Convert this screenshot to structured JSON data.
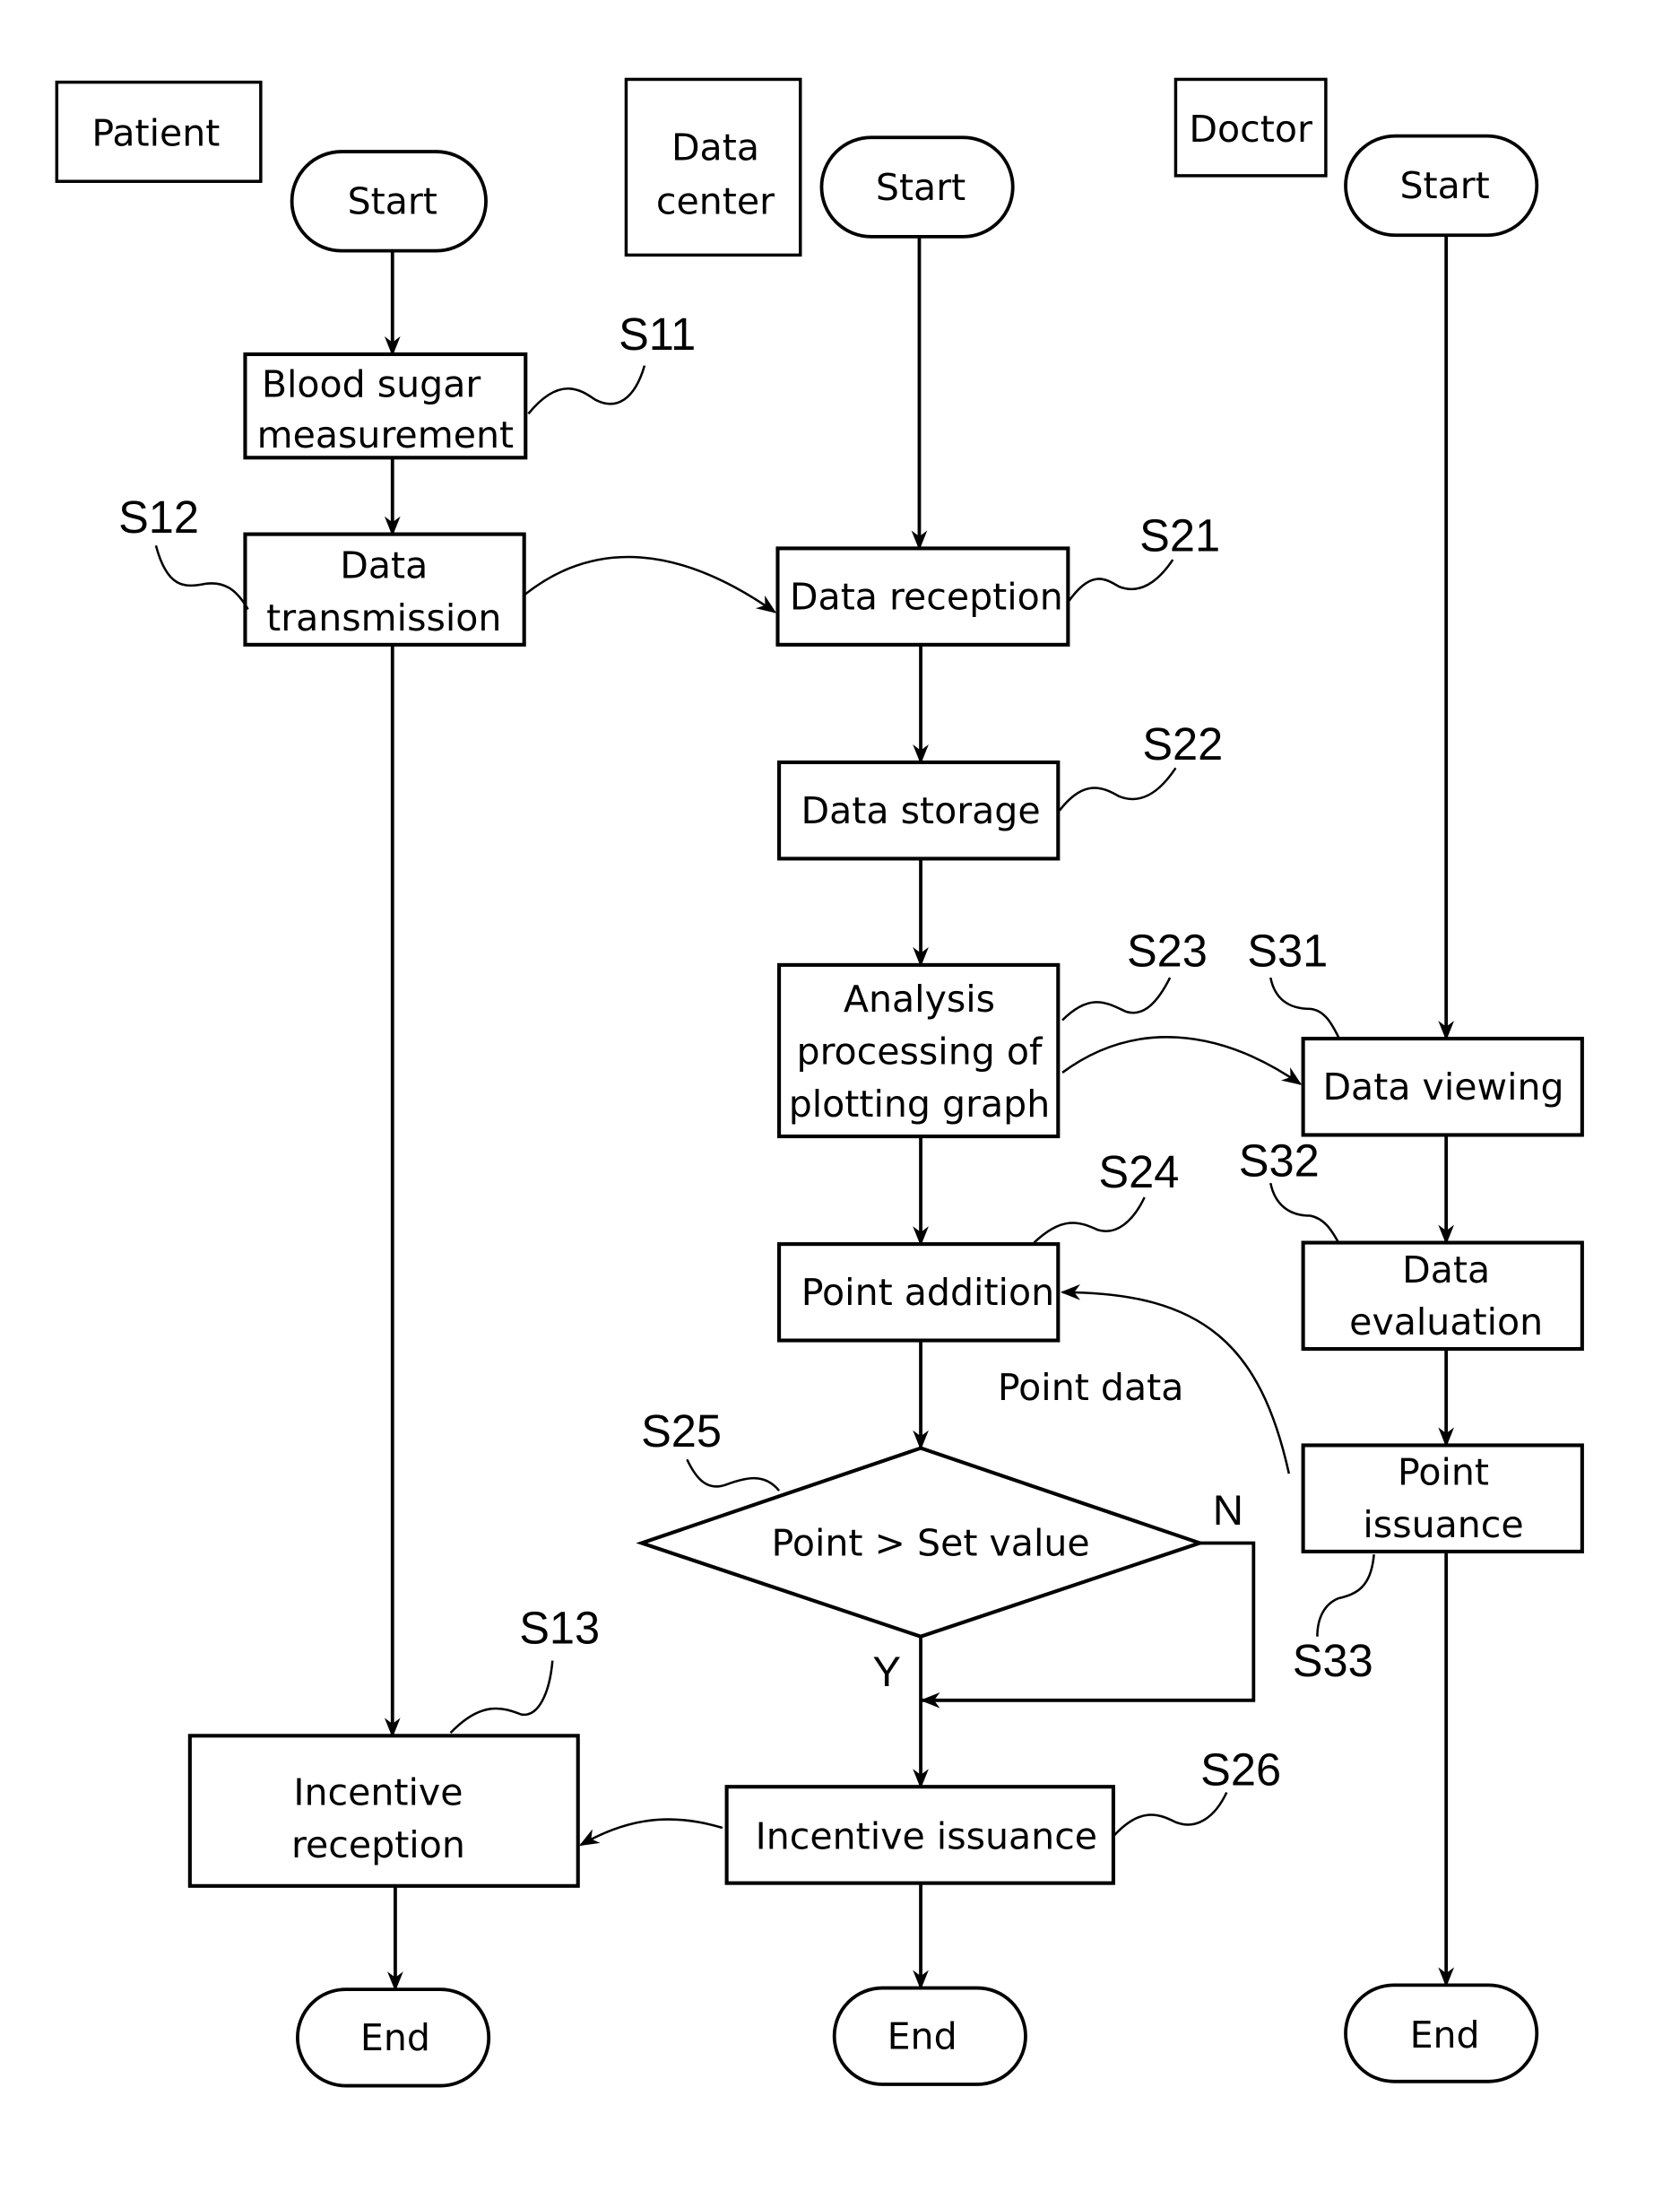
{
  "lanes": {
    "patient": "Patient",
    "data_center_line1": "Data",
    "data_center_line2": "center",
    "doctor": "Doctor"
  },
  "terminals": {
    "start": "Start",
    "end": "End"
  },
  "steps": {
    "S11": {
      "id": "S11",
      "line1": "Blood sugar",
      "line2": "measurement"
    },
    "S12": {
      "id": "S12",
      "line1": "Data",
      "line2": "transmission"
    },
    "S13": {
      "id": "S13",
      "line1": "Incentive",
      "line2": "reception"
    },
    "S21": {
      "id": "S21",
      "line1": "Data reception"
    },
    "S22": {
      "id": "S22",
      "line1": "Data storage"
    },
    "S23": {
      "id": "S23",
      "line1": "Analysis",
      "line2": "processing of",
      "line3": "plotting graph"
    },
    "S24": {
      "id": "S24",
      "line1": "Point addition"
    },
    "S25": {
      "id": "S25",
      "line1": "Point > Set value",
      "yes": "Y",
      "no": "N"
    },
    "S26": {
      "id": "S26",
      "line1": "Incentive issuance"
    },
    "S31": {
      "id": "S31",
      "line1": "Data viewing"
    },
    "S32": {
      "id": "S32",
      "line1": "Data",
      "line2": "evaluation"
    },
    "S33": {
      "id": "S33",
      "line1": "Point",
      "line2": "issuance"
    }
  },
  "annotations": {
    "point_data": "Point data"
  }
}
